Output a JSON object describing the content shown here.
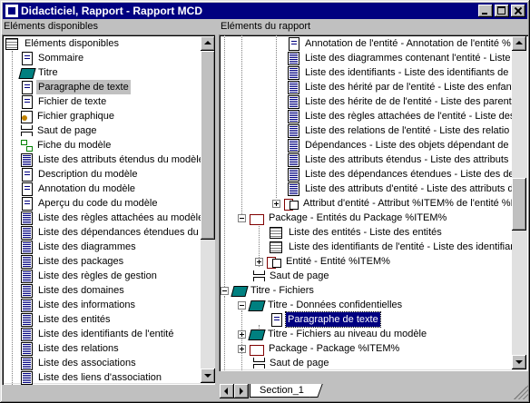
{
  "window": {
    "title": "Didacticiel, Rapport - Rapport MCD"
  },
  "left_pane": {
    "header": "Eléments disponibles",
    "items": [
      {
        "label": "Eléments disponibles",
        "icon": "table-icon"
      },
      {
        "label": "Sommaire",
        "icon": "page-icon"
      },
      {
        "label": "Titre",
        "icon": "book-icon"
      },
      {
        "label": "Paragraphe de texte",
        "icon": "page-icon",
        "selected": true
      },
      {
        "label": "Fichier de texte",
        "icon": "page-icon"
      },
      {
        "label": "Fichier graphique",
        "icon": "graphic-icon"
      },
      {
        "label": "Saut de page",
        "icon": "page-break-icon"
      },
      {
        "label": "Fiche du modèle",
        "icon": "model-icon"
      },
      {
        "label": "Liste des attributs étendus du modèle",
        "icon": "list-icon"
      },
      {
        "label": "Description du modèle",
        "icon": "page-icon"
      },
      {
        "label": "Annotation du modèle",
        "icon": "page-icon"
      },
      {
        "label": "Aperçu du code du modèle",
        "icon": "page-icon"
      },
      {
        "label": "Liste des règles attachées au modèle",
        "icon": "list-icon"
      },
      {
        "label": "Liste des dépendances étendues du",
        "icon": "list-icon"
      },
      {
        "label": "Liste des diagrammes",
        "icon": "list-icon"
      },
      {
        "label": "Liste des packages",
        "icon": "list-icon"
      },
      {
        "label": "Liste des règles de gestion",
        "icon": "list-icon"
      },
      {
        "label": "Liste des domaines",
        "icon": "list-icon"
      },
      {
        "label": "Liste des informations",
        "icon": "list-icon"
      },
      {
        "label": "Liste des entités",
        "icon": "list-icon"
      },
      {
        "label": "Liste des identifiants de l'entité",
        "icon": "list-icon"
      },
      {
        "label": "Liste des relations",
        "icon": "list-icon"
      },
      {
        "label": "Liste des associations",
        "icon": "list-icon"
      },
      {
        "label": "Liste des liens d'association",
        "icon": "list-icon"
      }
    ]
  },
  "right_pane": {
    "header": "Eléments du rapport",
    "items": [
      {
        "label": "Annotation de l'entité - Annotation de l'entité %",
        "icon": "page-icon"
      },
      {
        "label": "Liste des diagrammes contenant l'entité - Liste",
        "icon": "list-icon"
      },
      {
        "label": "Liste des identifiants - Liste des identifiants de l",
        "icon": "list-icon"
      },
      {
        "label": "Liste des hérité par de l'entité - Liste des enfant",
        "icon": "list-icon"
      },
      {
        "label": "Liste des hérite de de l'entité - Liste des parent",
        "icon": "list-icon"
      },
      {
        "label": "Liste des règles attachées de l'entité - Liste des",
        "icon": "list-icon"
      },
      {
        "label": "Liste des relations de l'entité - Liste des relatio",
        "icon": "list-icon"
      },
      {
        "label": "Dépendances - Liste des objets dépendant de",
        "icon": "list-icon"
      },
      {
        "label": "Liste des attributs étendus - Liste des attributs é",
        "icon": "list-icon"
      },
      {
        "label": "Liste des dépendances étendues - Liste des de",
        "icon": "list-icon"
      },
      {
        "label": "Liste des attributs d'entité - Liste des attributs d",
        "icon": "list-icon"
      },
      {
        "label": "Attribut d'entité - Attribut %ITEM% de l'entité %P",
        "icon": "entity-icon"
      },
      {
        "label": "Package - Entités du Package %ITEM%",
        "icon": "open-book-icon"
      },
      {
        "label": "Liste des entités - Liste des entités",
        "icon": "table-icon"
      },
      {
        "label": "Liste des identifiants de l'entité - Liste des identifian",
        "icon": "table-icon"
      },
      {
        "label": "Entité - Entité %ITEM%",
        "icon": "entity-icon"
      },
      {
        "label": "Saut de page",
        "icon": "page-break-icon"
      },
      {
        "label": "Titre - Fichiers",
        "icon": "book-icon"
      },
      {
        "label": "Titre - Données confidentielles",
        "icon": "book-icon"
      },
      {
        "label": "Paragraphe de texte",
        "icon": "page-icon",
        "focused": true
      },
      {
        "label": "Titre - Fichiers au niveau du modèle",
        "icon": "book-icon"
      },
      {
        "label": "Package - Package %ITEM%",
        "icon": "open-book-icon"
      },
      {
        "label": "Saut de page",
        "icon": "page-break-icon"
      }
    ]
  },
  "tabs": [
    {
      "label": "Section_1"
    }
  ]
}
